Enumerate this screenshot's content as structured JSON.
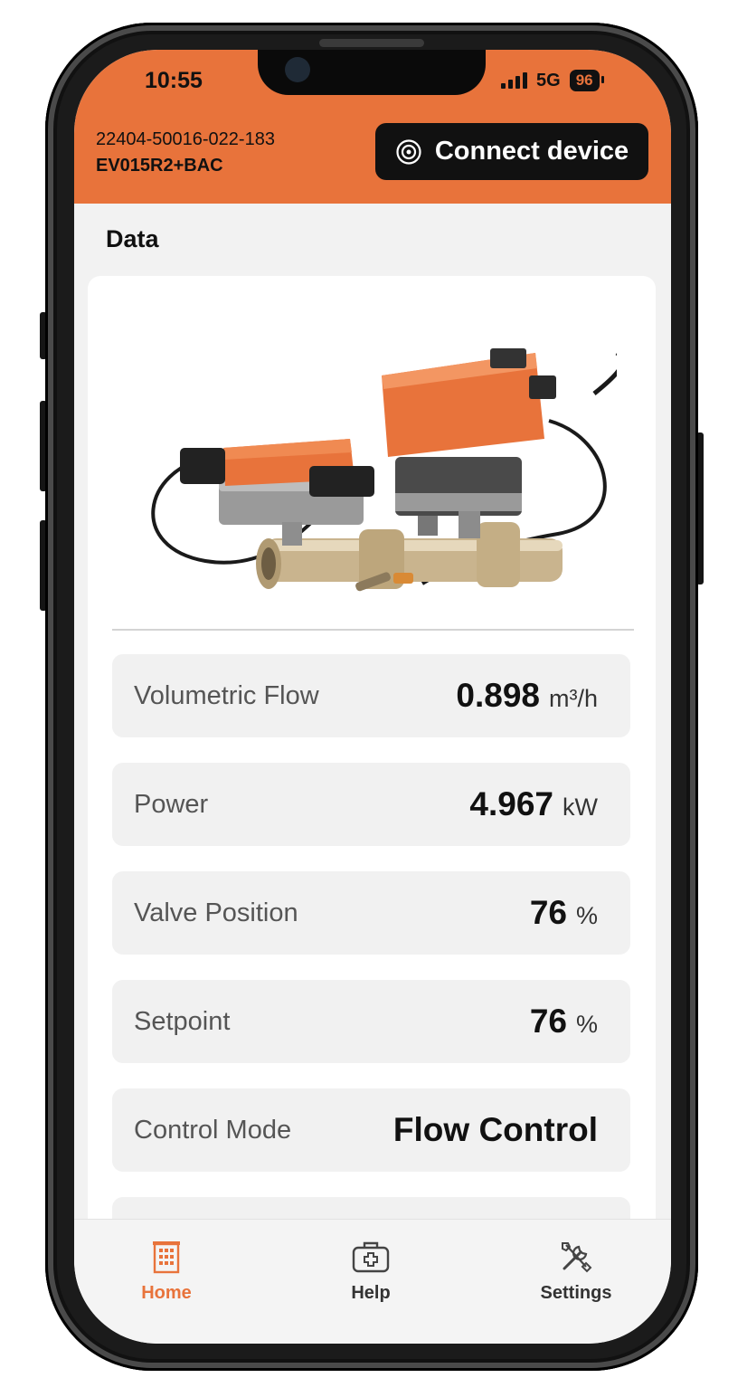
{
  "status_bar": {
    "time": "10:55",
    "network": "5G",
    "battery": "96"
  },
  "header": {
    "serial_number": "22404-50016-022-183",
    "model": "EV015R2+BAC",
    "connect_button": "Connect device"
  },
  "section_title": "Data",
  "product_image": {
    "icon": "valve-actuator-product-photo"
  },
  "readings": [
    {
      "label": "Volumetric Flow",
      "value": "0.898",
      "unit": "m³/h"
    },
    {
      "label": "Power",
      "value": "4.967",
      "unit": "kW"
    },
    {
      "label": "Valve Position",
      "value": "76",
      "unit": "%"
    },
    {
      "label": "Setpoint",
      "value": "76",
      "unit": "%"
    },
    {
      "label": "Control Mode",
      "value": "Flow Control",
      "unit": ""
    }
  ],
  "nav": {
    "home": "Home",
    "help": "Help",
    "settings": "Settings"
  },
  "colors": {
    "accent": "#e8733b",
    "button_bg": "#111111"
  }
}
